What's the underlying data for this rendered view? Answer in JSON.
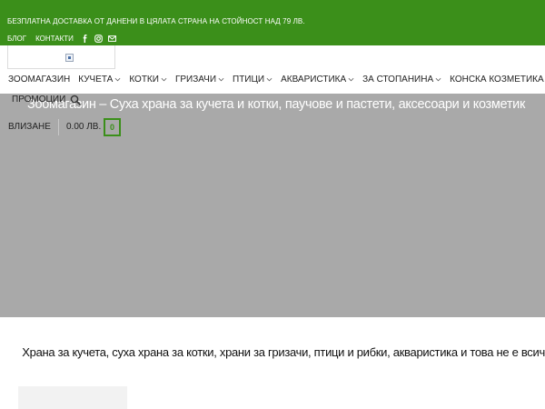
{
  "topbar": {
    "promo_text": "БЕЗПЛАТНА ДОСТАВКА ОТ ДАНЕНИ В ЦЯЛАТА СТРАНА НА СТОЙНОСТ НАД 79 ЛВ.",
    "links": [
      "БЛОГ",
      "КОНТАКТИ"
    ],
    "social_icons": [
      "facebook-icon",
      "instagram-icon",
      "email-icon"
    ],
    "background_color": "#3b8f1a"
  },
  "nav": {
    "items": [
      {
        "label": "ЗООМАГАЗИН",
        "has_dropdown": false
      },
      {
        "label": "КУЧЕТА",
        "has_dropdown": true
      },
      {
        "label": "КОТКИ",
        "has_dropdown": true
      },
      {
        "label": "ГРИЗАЧИ",
        "has_dropdown": true
      },
      {
        "label": "ПТИЦИ",
        "has_dropdown": true
      },
      {
        "label": "АКВАРИСТИКА",
        "has_dropdown": true
      },
      {
        "label": "ЗА СТОПАНИНА",
        "has_dropdown": true
      },
      {
        "label": "КОНСКА КОЗМЕТИКА",
        "has_dropdown": true
      }
    ],
    "promo_label": "ПРОМОЦИИ"
  },
  "header": {
    "login_label": "ВЛИЗАНЕ",
    "cart_total": "0.00 ЛВ.",
    "cart_count": "0"
  },
  "hero": {
    "title": "Зоомагазин – Суха храна за кучета и котки, паучове и пастети, аксесоари и козметик",
    "background_color": "#a9a9a9"
  },
  "tagline": "Храна за кучета, суха храна за котки, храни за гризачи, птици и рибки, аквариcтика и това не е всичко!"
}
